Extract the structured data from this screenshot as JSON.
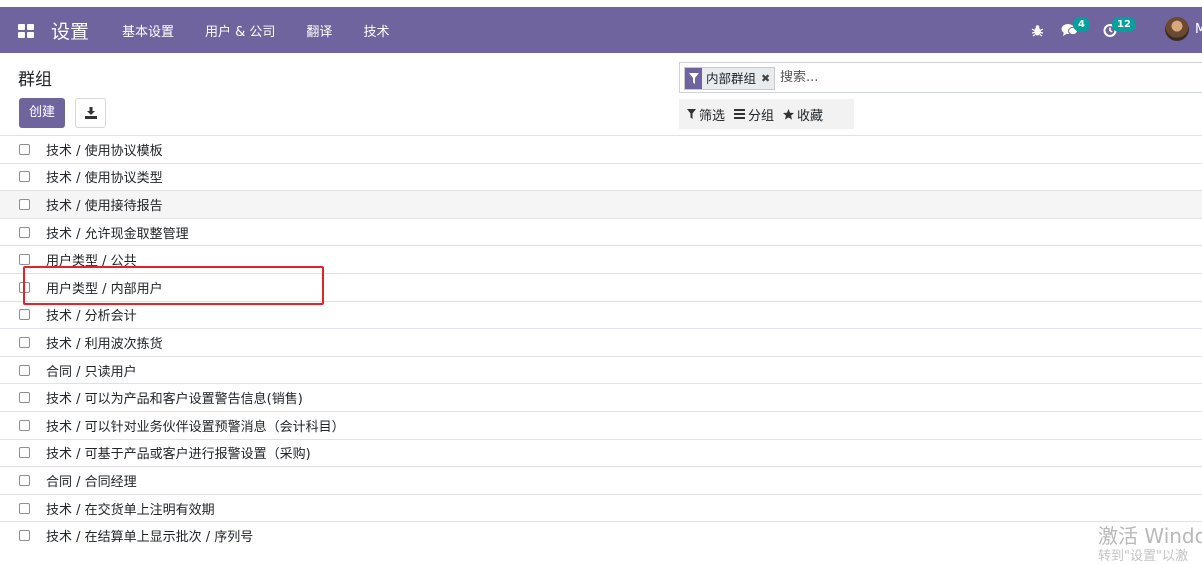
{
  "navbar": {
    "app_title": "设置",
    "menu": [
      "基本设置",
      "用户 & 公司",
      "翻译",
      "技术"
    ],
    "messages_count": "4",
    "activities_count": "12",
    "user_initial": "M"
  },
  "control_panel": {
    "breadcrumb": "群组",
    "create_label": "创建",
    "search": {
      "facet_value": "内部群组",
      "placeholder": "搜索..."
    },
    "filter_label": "筛选",
    "groupby_label": "分组",
    "favorites_label": "收藏"
  },
  "list": {
    "rows": [
      "技术 / 使用协议模板",
      "技术 / 使用协议类型",
      "技术 / 使用接待报告",
      "技术 / 允许现金取整管理",
      "用户类型 / 公共",
      "用户类型 / 内部用户",
      "技术 / 分析会计",
      "技术 / 利用波次拣货",
      "合同 / 只读用户",
      "技术 / 可以为产品和客户设置警告信息(销售)",
      "技术 / 可以针对业务伙伴设置预警消息（会计科目）",
      "技术 / 可基于产品或客户进行报警设置（采购)",
      "合同 / 合同经理",
      "技术 / 在交货单上注明有效期",
      "技术 / 在结算单上显示批次 / 序列号"
    ],
    "highlighted_row": "用户类型 / 内部用户"
  },
  "watermark": {
    "line1": "激活 Windo",
    "line2": "转到\"设置\"以激"
  },
  "colors": {
    "brand": "#6f649d",
    "badge": "#00a09d",
    "highlight": "#e5212b"
  }
}
